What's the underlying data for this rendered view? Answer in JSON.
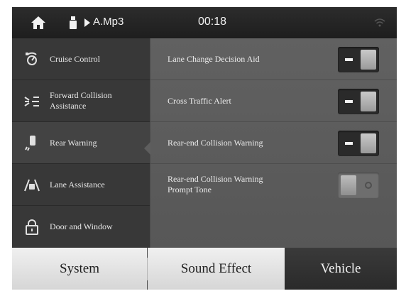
{
  "status_bar": {
    "home_icon": "home-icon",
    "source_icon": "usb-icon",
    "play_icon": "play-icon",
    "track_title": "A.Mp3",
    "time": "00:18",
    "signal_icon": "wifi-signal-icon"
  },
  "sidebar": {
    "items": [
      {
        "label_lines": [
          "Cruise Control"
        ],
        "icon": "cruise-control-icon",
        "active": false
      },
      {
        "label_lines": [
          "Forward Collision",
          "Assistance"
        ],
        "icon": "forward-collision-icon",
        "active": false
      },
      {
        "label_lines": [
          "Rear Warning"
        ],
        "icon": "rear-warning-icon",
        "active": true
      },
      {
        "label_lines": [
          "Lane Assistance"
        ],
        "icon": "lane-assistance-icon",
        "active": false
      },
      {
        "label_lines": [
          "Door and Window"
        ],
        "icon": "lock-icon",
        "active": false
      }
    ]
  },
  "settings": {
    "rows": [
      {
        "label_lines": [
          "Lane Change Decision Aid"
        ],
        "toggle_on": true
      },
      {
        "label_lines": [
          "Cross Traffic Alert"
        ],
        "toggle_on": true
      },
      {
        "label_lines": [
          "Rear-end Collision Warning"
        ],
        "toggle_on": true
      },
      {
        "label_lines": [
          "Rear-end Collision Warning",
          "Prompt Tone"
        ],
        "toggle_on": false
      }
    ]
  },
  "tabs": [
    {
      "label": "System",
      "selected": false
    },
    {
      "label": "Sound Effect",
      "selected": false
    },
    {
      "label": "Vehicle",
      "selected": true
    }
  ],
  "colors": {
    "status_bar_bg": "#262626",
    "sidebar_bg": "#383838",
    "panel_bg": "#5c5c5c",
    "toggle_on_bg": "#2a2a2a",
    "toggle_off_bg": "#6e6e6e",
    "tab_light_bg": "#e2e2e2",
    "tab_selected_bg": "#303030"
  }
}
